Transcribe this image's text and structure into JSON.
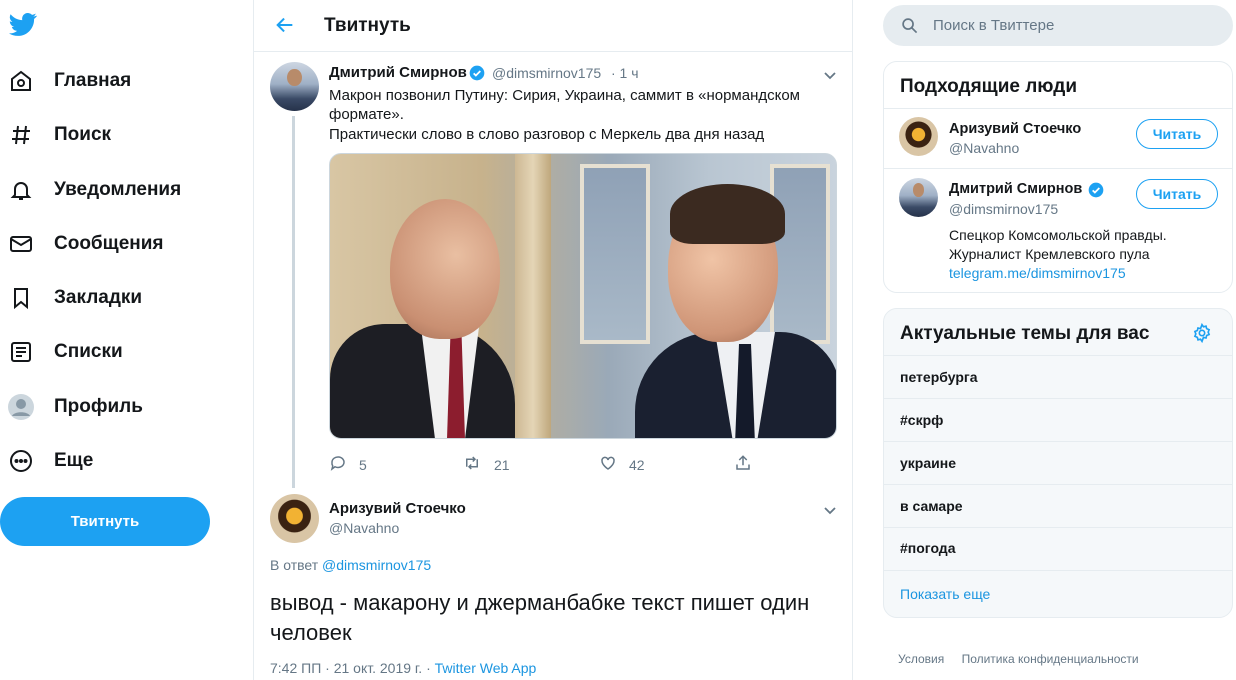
{
  "nav": {
    "items": [
      {
        "label": "Главная",
        "icon": "home-icon"
      },
      {
        "label": "Поиск",
        "icon": "hashtag-icon"
      },
      {
        "label": "Уведомления",
        "icon": "bell-icon"
      },
      {
        "label": "Сообщения",
        "icon": "envelope-icon"
      },
      {
        "label": "Закладки",
        "icon": "bookmark-icon"
      },
      {
        "label": "Списки",
        "icon": "list-icon"
      },
      {
        "label": "Профиль",
        "icon": "avatar-icon"
      },
      {
        "label": "Еще",
        "icon": "more-icon"
      }
    ],
    "tweet_button": "Твитнуть"
  },
  "header": {
    "title": "Твитнуть"
  },
  "tweet": {
    "name": "Дмитрий Смирнов",
    "handle": "@dimsmirnov175",
    "time": "· 1 ч",
    "text_line1": "Макрон позвонил Путину: Сирия, Украина, саммит в «нормандском",
    "text_line2": "формате».",
    "text_line3": "Практически слово в слово разговор с Меркель два дня назад",
    "replies": "5",
    "retweets": "21",
    "likes": "42"
  },
  "reply": {
    "name": "Аризувий Стоечко",
    "handle": "@Navahno",
    "reply_prefix": "В ответ",
    "reply_target": "@dimsmirnov175",
    "text": "вывод - макарону и джерманбабке текст пишет один человек",
    "meta_time": "7:42 ПП · 21 окт. 2019 г. ·",
    "meta_source": "Twitter Web App"
  },
  "search": {
    "placeholder": "Поиск в Твиттере"
  },
  "who_to_follow": {
    "title": "Подходящие люди",
    "users": [
      {
        "name": "Аризувий Стоечко",
        "handle": "@Navahno",
        "button": "Читать"
      },
      {
        "name": "Дмитрий Смирнов",
        "handle": "@dimsmirnov175",
        "button": "Читать",
        "bio_line1": "Спецкор Комсомольской правды.",
        "bio_line2": "Журналист Кремлевского пула",
        "bio_link": "telegram.me/dimsmirnov175"
      }
    ]
  },
  "trends": {
    "title": "Актуальные темы для вас",
    "items": [
      "петербурга",
      "#скрф",
      "украине",
      "в самаре",
      "#погода"
    ],
    "show_more": "Показать еще"
  },
  "footer": {
    "terms": "Условия",
    "privacy": "Политика конфиденциальности"
  },
  "colors": {
    "accent": "#1da1f2",
    "link": "#1b95e0",
    "muted": "#657786"
  }
}
